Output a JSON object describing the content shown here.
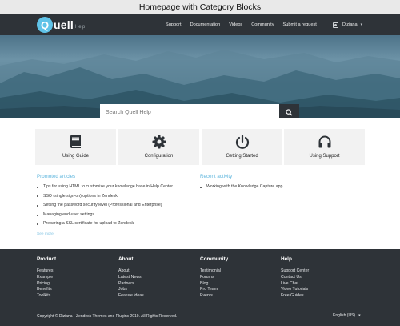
{
  "caption": "Homepage with Category Blocks",
  "brand": {
    "logo_letter": "Q",
    "logo_rest": "uell",
    "logo_sub": "Help"
  },
  "nav": {
    "links": [
      "Support",
      "Documentation",
      "Videos",
      "Community",
      "Submit a request"
    ],
    "user_name": "Diziana"
  },
  "search": {
    "placeholder": "Search Quell Help"
  },
  "categories": [
    {
      "label": "Using Guide",
      "icon": "book-icon"
    },
    {
      "label": "Configuration",
      "icon": "gear-icon"
    },
    {
      "label": "Getting Started",
      "icon": "power-icon"
    },
    {
      "label": "Using Support",
      "icon": "headphones-icon"
    }
  ],
  "promoted": {
    "title": "Promoted articles",
    "items": [
      "Tips for using HTML to customize your knowledge base in Help Center",
      "SSO (single sign-on) options in Zendesk",
      "Setting the password security level (Professional and Enterprise)",
      "Managing end-user settings",
      "Preparing a SSL certificate for upload to Zendesk"
    ],
    "see_more": "See more"
  },
  "recent": {
    "title": "Recent activity",
    "items": [
      "Working with the Knowledge Capture app"
    ]
  },
  "footer": {
    "columns": [
      {
        "title": "Product",
        "links": [
          "Features",
          "Example",
          "Pricing",
          "Benefits",
          "Toolkits"
        ]
      },
      {
        "title": "About",
        "links": [
          "About",
          "Latest News",
          "Partners",
          "Jobs",
          "Feature ideas"
        ]
      },
      {
        "title": "Community",
        "links": [
          "Testimonial",
          "Forums",
          "Blog",
          "Pro Team",
          "Events"
        ]
      },
      {
        "title": "Help",
        "links": [
          "Support Center",
          "Contact Us",
          "Live Chat",
          "Video Tutorials",
          "Free Guides"
        ]
      }
    ],
    "copyright": "Copyright © Diziana - Zendesk Themes and Plugins 2019. All Rights Reserved.",
    "language": "English (US)"
  },
  "colors": {
    "dark": "#2e3338",
    "accent": "#5fc3e8",
    "card": "#f2f2f2"
  }
}
